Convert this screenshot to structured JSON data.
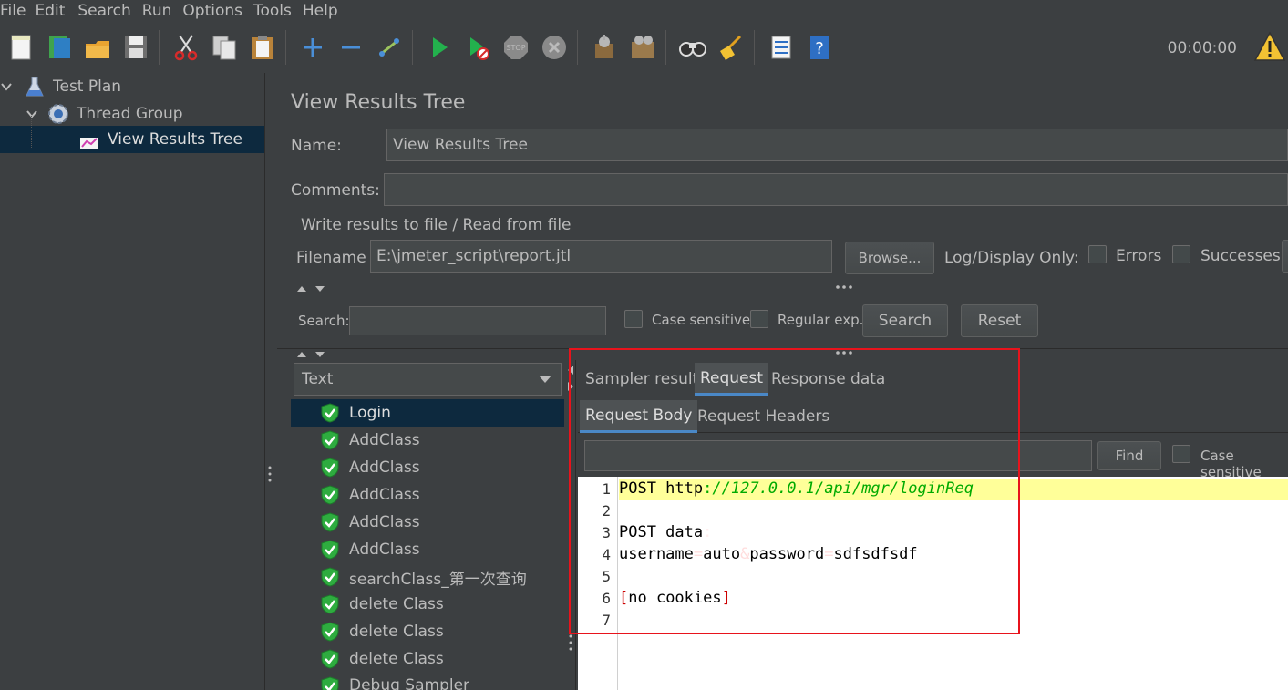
{
  "menu": [
    "File",
    "Edit",
    "Search",
    "Run",
    "Options",
    "Tools",
    "Help"
  ],
  "toolbar": {
    "icons": [
      "new-icon",
      "templates-icon",
      "open-icon",
      "save-icon",
      "cut-icon",
      "copy-icon",
      "paste-icon",
      "expand-icon",
      "collapse-icon",
      "toggle-icon",
      "start-icon",
      "start-no-pause-icon",
      "stop-icon",
      "shutdown-icon",
      "clear-icon",
      "clear-all-icon",
      "search-icon",
      "reset-search-icon",
      "function-helper-icon",
      "help-icon"
    ],
    "timer": "00:00:00"
  },
  "tree": {
    "items": [
      {
        "label": "Test Plan"
      },
      {
        "label": "Thread Group"
      },
      {
        "label": "View Results Tree"
      }
    ]
  },
  "panel": {
    "title": "View Results Tree",
    "name_label": "Name:",
    "name_value": "View Results Tree",
    "comments_label": "Comments:",
    "comments_value": "",
    "file_section_title": "Write results to file / Read from file",
    "filename_label": "Filename",
    "filename_value": "E:\\jmeter_script\\report.jtl",
    "browse_label": "Browse...",
    "log_display_label": "Log/Display Only:",
    "errors_label": "Errors",
    "successes_label": "Successes"
  },
  "search": {
    "label": "Search:",
    "value": "",
    "case_sensitive_label": "Case sensitive",
    "regex_label": "Regular exp.",
    "search_button": "Search",
    "reset_button": "Reset"
  },
  "results": {
    "renderer": "Text",
    "items": [
      {
        "label": "Login"
      },
      {
        "label": "AddClass"
      },
      {
        "label": "AddClass"
      },
      {
        "label": "AddClass"
      },
      {
        "label": "AddClass"
      },
      {
        "label": "AddClass"
      },
      {
        "label": "searchClass_第一次查询"
      },
      {
        "label": "delete Class"
      },
      {
        "label": "delete Class"
      },
      {
        "label": "delete Class"
      },
      {
        "label": "Debug Sampler"
      }
    ]
  },
  "tabs": {
    "main": [
      "Sampler result",
      "Request",
      "Response data"
    ],
    "sub": [
      "Request Body",
      "Request Headers"
    ],
    "find_value": "",
    "find_button": "Find",
    "find_case_label": "Case sensitive"
  },
  "editor": {
    "line_numbers": [
      "1",
      "2",
      "3",
      "4",
      "5",
      "6",
      "7"
    ],
    "line1_method": "POST http",
    "line1_colon": ":",
    "line1_url": "//127.0.0.1/api/mgr/loginReq",
    "line3": "POST data",
    "line3_colon": ":",
    "line4_a": "username",
    "line4_eq1": "=",
    "line4_b": "auto",
    "line4_amp": "&",
    "line4_c": "password",
    "line4_eq2": "=",
    "line4_d": "sdfsdfsdf",
    "line6_open": "[",
    "line6_text": "no cookies",
    "line6_close": "]"
  },
  "colors": {
    "background": "#3c3f41",
    "selection": "#0d293e",
    "highlight_box": "#e8131c",
    "line_highlight": "#ffff99"
  }
}
